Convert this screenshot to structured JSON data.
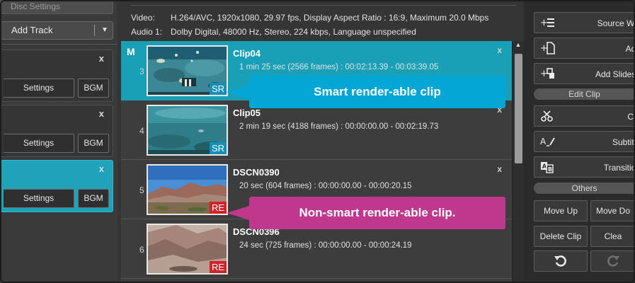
{
  "left": {
    "disc_settings": "Disc Settings",
    "add_track": "Add Track",
    "tracks": [
      {
        "settings": "Settings",
        "bgm": "BGM"
      },
      {
        "settings": "Settings",
        "bgm": "BGM"
      },
      {
        "settings": "Settings",
        "bgm": "BGM"
      }
    ],
    "close_glyph": "x"
  },
  "info": {
    "video_label": "Video:",
    "video_value": "H.264/AVC,  1920x1080,  29.97 fps,  Display Aspect Ratio : 16:9,  Maximum 20.0 Mbps",
    "audio_label": "Audio 1:",
    "audio_value": "Dolby Digital,  48000  Hz,  Stereo,  224 kbps,  Language unspecified"
  },
  "clips": [
    {
      "marker": "M",
      "number": "3",
      "name": "Clip04",
      "detail": "1 min 25 sec (2566 frames) : 00:02:13.39 - 00:03:39.05",
      "badge": "SR"
    },
    {
      "marker": "",
      "number": "4",
      "name": "Clip05",
      "detail": "2 min 19 sec (4188 frames) : 00:00:00.00 - 00:02:19.73",
      "badge": "SR"
    },
    {
      "marker": "",
      "number": "5",
      "name": "DSCN0390",
      "detail": "20 sec (604 frames) : 00:00:00.00 - 00:00:20.15",
      "badge": "RE"
    },
    {
      "marker": "",
      "number": "6",
      "name": "DSCN0396",
      "detail": "24 sec (725 frames) : 00:00:00.00 - 00:00:24.19",
      "badge": "RE"
    }
  ],
  "callouts": {
    "smart": "Smart render-able clip",
    "non_smart": "Non-smart render-able clip."
  },
  "right": {
    "source_wizard": "Source Wiz",
    "add": "Add",
    "add_slideshow": "Add Slidesh",
    "edit_clip": "Edit Clip",
    "cut": "Cut",
    "subtitle": "Subtitle",
    "transition": "Transition",
    "others": "Others",
    "move_up": "Move Up",
    "move_down": "Move Do",
    "delete_clip": "Delete Clip",
    "clear": "Clea"
  },
  "colors": {
    "selected": "#19a0b7",
    "sr_badge": "#138fb8",
    "re_badge": "#d0232a",
    "smart_callout": "#04a6d6",
    "non_smart_callout": "#c0388d"
  }
}
